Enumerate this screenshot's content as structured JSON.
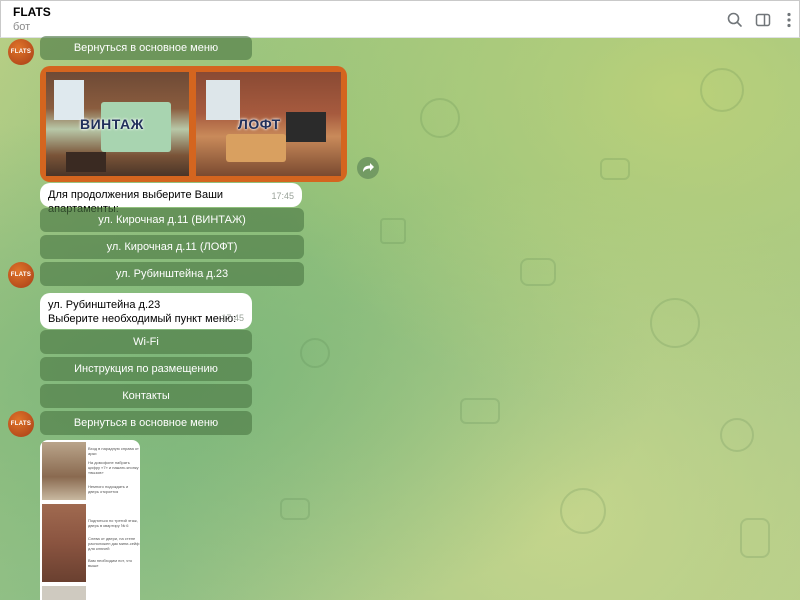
{
  "header": {
    "title": "FLATS",
    "subtitle": "бот",
    "icons": [
      "search-icon",
      "sidebar-icon",
      "more-vertical-icon"
    ]
  },
  "avatar": {
    "text": "FLATS"
  },
  "messages": {
    "top_button": "Вернуться в основное меню",
    "photo": {
      "label_left": "ВИНТАЖ",
      "label_right": "ЛОФТ"
    },
    "choose": {
      "text": "Для продолжения выберите Ваши апартаменты:",
      "time": "17:45",
      "buttons": [
        "ул. Кирочная д.11 (ВИНТАЖ)",
        "ул. Кирочная д.11 (ЛОФТ)",
        "ул. Рубинштейна д.23"
      ]
    },
    "menu": {
      "line1": "ул. Рубинштейна д.23",
      "line2": "Выберите необходимый пункт меню:",
      "time": "17:45",
      "buttons": [
        "Wi-Fi",
        "Инструкция по размещению",
        "Контакты",
        "Вернуться в основное меню"
      ]
    },
    "doc": {
      "text1": "Вход в парадную справа от арки",
      "text2": "На домофоне набрать цифру «7» и нажать кнопку «вызов»",
      "text3": "Немного подождать и дверь откроется",
      "text4": "Подняться по третий этаж, дверь в квартиру № 6",
      "text5": "Слева от двери, на стене расположен дак мини-сейф для ключей",
      "text6": "Вам необходим пот, что выше"
    }
  },
  "colors": {
    "button_bg": "#4c7844",
    "avatar": "#c2541f",
    "photo_border": "#d4651f"
  }
}
